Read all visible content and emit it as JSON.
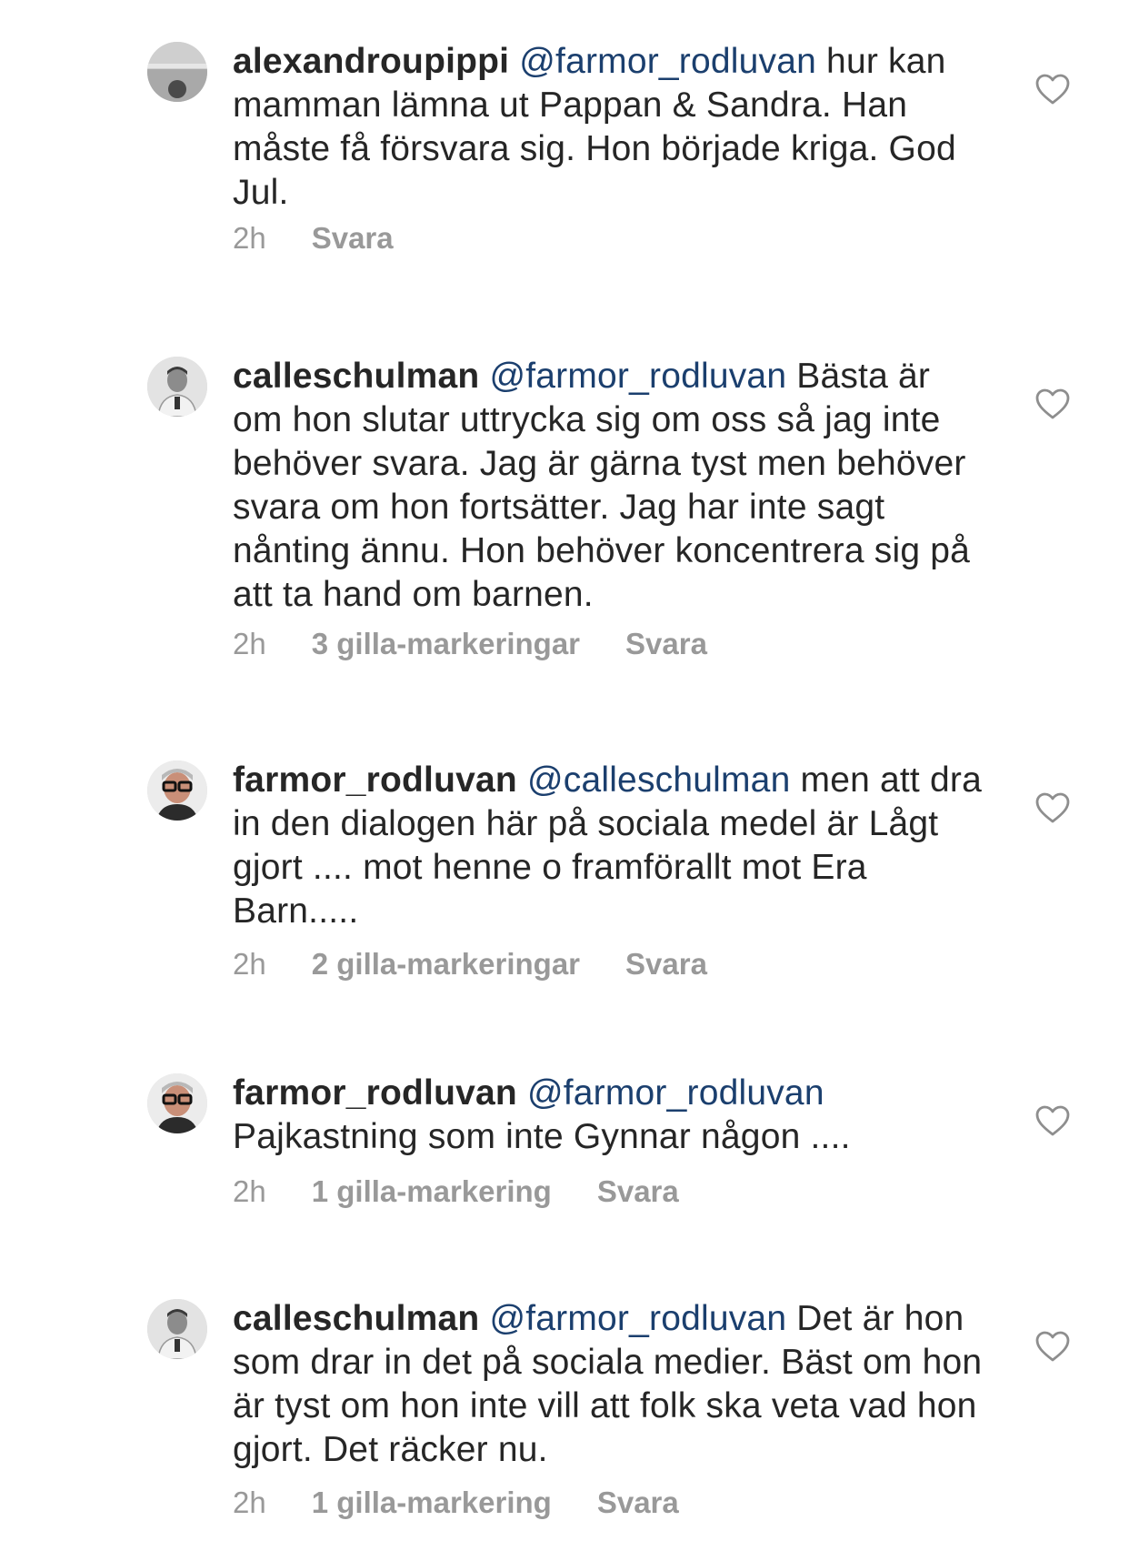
{
  "comments": [
    {
      "username": "alexandroupippi",
      "mention": "@farmor_rodluvan",
      "text": " hur kan mamman lämna ut Pappan & Sandra. Han måste få försvara sig. Hon började kriga. God Jul.",
      "time": "2h",
      "likes": "",
      "reply": "Svara"
    },
    {
      "username": "calleschulman",
      "mention": "@farmor_rodluvan",
      "text": " Bästa är om hon slutar uttrycka sig om oss så jag inte behöver svara. Jag är gärna tyst men behöver svara om hon fortsätter. Jag har inte sagt nånting ännu. Hon behöver koncentrera sig på att ta hand om barnen.",
      "time": "2h",
      "likes": "3 gilla-markeringar",
      "reply": "Svara"
    },
    {
      "username": "farmor_rodluvan",
      "mention": "@calleschulman",
      "text": " men att dra in den dialogen här på sociala medel är Lågt gjort .... mot henne o framförallt mot Era Barn.....",
      "time": "2h",
      "likes": "2 gilla-markeringar",
      "reply": "Svara"
    },
    {
      "username": "farmor_rodluvan",
      "mention": "@farmor_rodluvan",
      "text": " Pajkastning som inte Gynnar någon ....",
      "time": "2h",
      "likes": "1 gilla-markering",
      "reply": "Svara"
    },
    {
      "username": "calleschulman",
      "mention": "@farmor_rodluvan",
      "text": " Det är hon som drar in det på sociala medier. Bäst om hon är tyst om hon inte vill att folk ska veta vad hon gjort. Det räcker nu.",
      "time": "2h",
      "likes": "1 gilla-markering",
      "reply": "Svara"
    }
  ],
  "icons": {
    "like": "heart-outline-icon",
    "avatar": "user-avatar"
  },
  "colors": {
    "text": "#262626",
    "mention": "#1b3f6e",
    "meta": "#999999",
    "heart": "#8e8e8e"
  }
}
